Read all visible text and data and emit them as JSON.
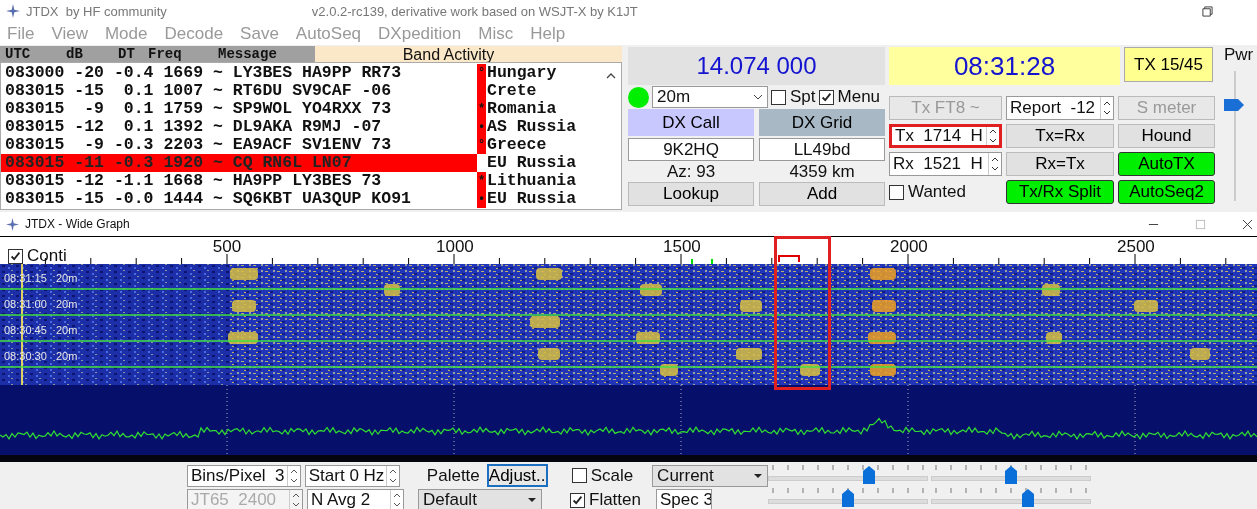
{
  "title_bar": {
    "app": "JTDX  by HF community",
    "version": "v2.0.2-rc139, derivative work based on WSJT-X by K1JT"
  },
  "menu": [
    "File",
    "View",
    "Mode",
    "Decode",
    "Save",
    "AutoSeq",
    "DXpedition",
    "Misc",
    "Help"
  ],
  "band_activity": {
    "columns": [
      "UTC",
      "dB",
      "DT",
      "Freq",
      "Message"
    ],
    "title": "Band Activity",
    "rows": [
      {
        "text": "083000 -20 -0.4 1669 ~ LY3BES HA9PP RR73",
        "mark": "°",
        "country": "Hungary",
        "highlighted": false
      },
      {
        "text": "083015 -15  0.1 1007 ~ RT6DU SV9CAF -06",
        "country": "Crete",
        "highlighted": false
      },
      {
        "text": "083015  -9  0.1 1759 ~ SP9WOL YO4RXX 73",
        "mark": "*",
        "country": "Romania",
        "highlighted": false
      },
      {
        "text": "083015 -12  0.1 1392 ~ DL9AKA R9MJ -07",
        "mark": "•",
        "country": "AS Russia",
        "highlighted": false
      },
      {
        "text": "083015  -9 -0.3 2203 ~ EA9ACF SV1ENV 73",
        "mark": "°",
        "country": "Greece",
        "highlighted": false
      },
      {
        "text": "083015 -11 -0.3 1920 ~ CQ RN6L LN07",
        "country": "EU Russia",
        "highlighted": true
      },
      {
        "text": "083015 -12 -1.1 1668 ~ HA9PP LY3BES 73",
        "mark": "*",
        "country": "Lithuania",
        "highlighted": false
      },
      {
        "text": "083015 -15 -0.0 1444 ~ SQ6KBT UA3QUP KO91",
        "mark": "•",
        "country": "EU Russia",
        "highlighted": false
      }
    ]
  },
  "controls": {
    "frequency": "14.074 000",
    "clock": "08:31:28",
    "tx_period": "TX 15/45",
    "power_label": "Pwr",
    "power": {
      "level": 0.74
    },
    "status_on": true,
    "band": "20m",
    "spt": {
      "label": "Spt",
      "checked": false
    },
    "menu_toggle": {
      "label": "Menu",
      "checked": true
    },
    "dx_call": {
      "label": "DX Call",
      "value": "9K2HQ",
      "info": "Az: 93",
      "button": "Lookup"
    },
    "dx_grid": {
      "label": "DX Grid",
      "value": "LL49bd",
      "info": "4359 km",
      "button": "Add"
    },
    "grid": [
      {
        "kind": "button",
        "label": "Tx FT8 ~",
        "on": false,
        "disabled": true
      },
      {
        "kind": "spinner",
        "label": "Report",
        "value": "-12"
      },
      {
        "kind": "button",
        "label": "S meter",
        "on": false,
        "disabled": true
      },
      {
        "kind": "spinner",
        "label": "Tx",
        "value": "1714",
        "unit": "H",
        "highlighted": true
      },
      {
        "kind": "button",
        "label": "Tx=Rx",
        "on": false,
        "disabled": false
      },
      {
        "kind": "button",
        "label": "Hound",
        "on": false,
        "disabled": false
      },
      {
        "kind": "spinner",
        "label": "Rx",
        "value": "1521",
        "unit": "H"
      },
      {
        "kind": "button",
        "label": "Rx=Tx",
        "on": false,
        "disabled": false
      },
      {
        "kind": "button",
        "label": "AutoTX",
        "on": true,
        "disabled": false
      },
      {
        "kind": "checkbox",
        "label": "Wanted",
        "checked": false
      },
      {
        "kind": "button",
        "label": "Tx/Rx Split",
        "on": true,
        "disabled": false
      },
      {
        "kind": "button",
        "label": "AutoSeq2",
        "on": true,
        "disabled": false
      }
    ]
  },
  "wide_graph": {
    "title": "JTDX - Wide Graph",
    "conti": {
      "label": "Conti",
      "checked": true
    },
    "ticks": [
      "500",
      "1000",
      "1500",
      "2000",
      "2500"
    ],
    "tx_highlighted": true,
    "waterfall_labels": [
      {
        "time": "08:31:15",
        "band": "20m"
      },
      {
        "time": "08:31:00",
        "band": "20m"
      },
      {
        "time": "08:30:45",
        "band": "20m"
      },
      {
        "time": "08:30:30",
        "band": "20m"
      }
    ],
    "control_rows": [
      [
        {
          "kind": "spinner",
          "text": "Bins/Pixel  3",
          "disabled": false
        },
        {
          "kind": "spinner",
          "text": "Start 0 Hz",
          "disabled": false
        },
        {
          "kind": "label",
          "text": "Palette"
        },
        {
          "kind": "button",
          "text": "Adjust.."
        },
        {
          "kind": "checkbox",
          "text": "Scale",
          "checked": false
        },
        {
          "kind": "dropdown",
          "text": "Current"
        }
      ],
      [
        {
          "kind": "spinner",
          "text": "JT65  2400",
          "disabled": true
        },
        {
          "kind": "spinner",
          "text": "N Avg 2",
          "disabled": false
        },
        {
          "kind": "dropdown",
          "text": "Default"
        },
        {
          "kind": "checkbox",
          "text": "Flatten",
          "checked": true
        },
        {
          "kind": "spinner",
          "text": "Spec 3",
          "disabled": false
        }
      ]
    ],
    "sliders": [
      {
        "level": 0.63
      },
      {
        "level": 0.5
      },
      {
        "level": 0.5
      },
      {
        "level": 0.61
      }
    ]
  }
}
